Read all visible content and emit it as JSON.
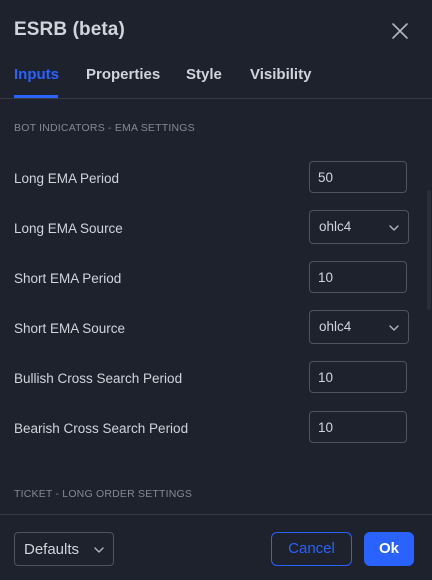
{
  "dialog": {
    "title": "ESRB (beta)"
  },
  "tabs": [
    {
      "label": "Inputs",
      "active": true
    },
    {
      "label": "Properties",
      "active": false
    },
    {
      "label": "Style",
      "active": false
    },
    {
      "label": "Visibility",
      "active": false
    }
  ],
  "sections": {
    "ema_header": "BOT INDICATORS - EMA SETTINGS",
    "ticket_header": "TICKET - LONG ORDER SETTINGS"
  },
  "inputs": {
    "long_ema_period": {
      "label": "Long EMA Period",
      "value": "50"
    },
    "long_ema_source": {
      "label": "Long EMA Source",
      "value": "ohlc4"
    },
    "short_ema_period": {
      "label": "Short EMA Period",
      "value": "10"
    },
    "short_ema_source": {
      "label": "Short EMA Source",
      "value": "ohlc4"
    },
    "bullish_cross": {
      "label": "Bullish Cross Search Period",
      "value": "10"
    },
    "bearish_cross": {
      "label": "Bearish Cross Search Period",
      "value": "10"
    }
  },
  "footer": {
    "defaults_label": "Defaults",
    "cancel_label": "Cancel",
    "ok_label": "Ok"
  },
  "colors": {
    "background": "#1e222d",
    "accent": "#2962ff",
    "text": "#d1d4dc",
    "muted": "#868993",
    "border": "#50535e"
  },
  "icons": {
    "close": "close-icon",
    "dropdown": "chevron-down-icon"
  }
}
